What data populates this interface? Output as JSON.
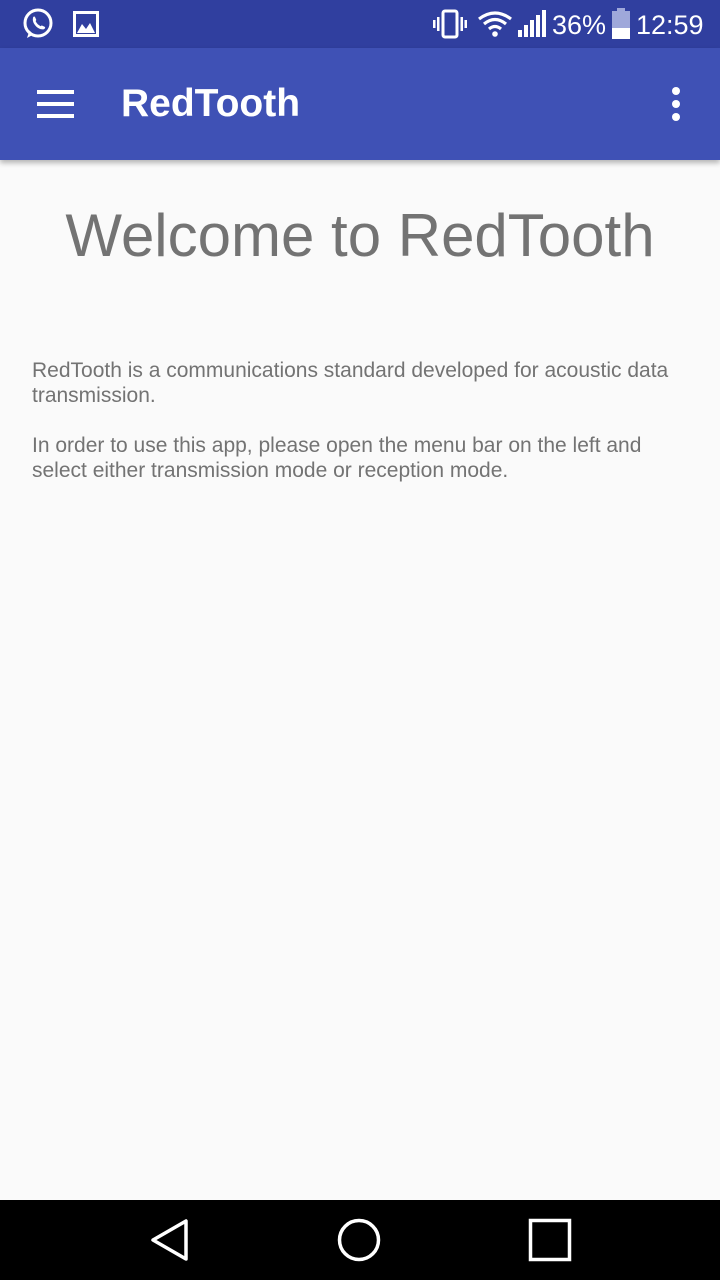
{
  "status_bar": {
    "battery_percent": "36%",
    "battery_level": 0.36,
    "time": "12:59",
    "icons": [
      "whatsapp-icon",
      "image-icon",
      "vibrate-icon",
      "wifi-icon",
      "signal-icon",
      "battery-icon"
    ],
    "background_color": "#303f9f"
  },
  "app_bar": {
    "title": "RedTooth",
    "menu_icon": "hamburger-menu-icon",
    "overflow_icon": "more-vert-icon",
    "background_color": "#3f51b5"
  },
  "main": {
    "heading": "Welcome to RedTooth",
    "paragraph_1": "RedTooth is a communications standard developed for acoustic data transmission.",
    "paragraph_2": "In order to use this app, please open the menu bar on the left and select either transmission mode or reception mode."
  },
  "nav_bar": {
    "buttons": [
      "back-icon",
      "home-icon",
      "recents-icon"
    ]
  }
}
